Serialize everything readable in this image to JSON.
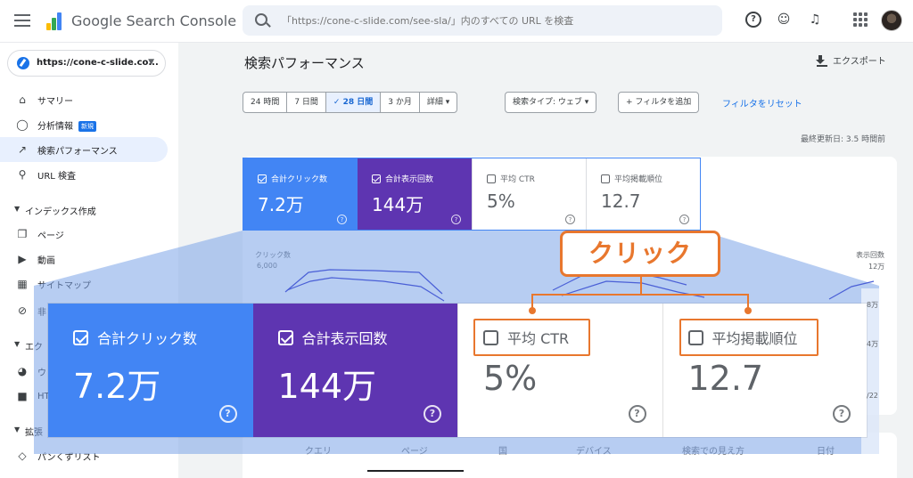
{
  "app": {
    "title": "Google Search Console"
  },
  "search": {
    "placeholder": "「https://cone-c-slide.com/see-sla/」内のすべての URL を検査"
  },
  "property": {
    "label": "https://cone-c-slide.co..."
  },
  "sidebar": {
    "items": [
      {
        "label": "サマリー",
        "icon": "home-icon"
      },
      {
        "label": "分析情報",
        "icon": "lightbulb-icon",
        "badge": "新規"
      },
      {
        "label": "検索パフォーマンス",
        "icon": "trending-up-icon",
        "active": true
      },
      {
        "label": "URL 検査",
        "icon": "search-icon"
      }
    ],
    "section_index": "インデックス作成",
    "index_items": [
      {
        "label": "ページ",
        "icon": "pages-icon"
      },
      {
        "label": "動画",
        "icon": "video-icon"
      },
      {
        "label": "サイトマップ",
        "icon": "sitemap-icon"
      },
      {
        "label": "非",
        "icon": "hidden-icon"
      }
    ],
    "section_experience": "エク",
    "experience_items": [
      {
        "label": "ウ",
        "icon": "gauge-icon"
      },
      {
        "label": "HT",
        "icon": "lock-icon"
      }
    ],
    "section_extensions": "拡張",
    "extension_items": [
      {
        "label": "パンくずリスト",
        "icon": "layers-icon"
      }
    ]
  },
  "main": {
    "title": "検索パフォーマンス",
    "export_label": "エクスポート",
    "date_ranges": [
      "24 時間",
      "7 日間",
      "28 日間",
      "3 か月",
      "詳細"
    ],
    "selected_range": "28 日間",
    "search_type": "検索タイプ: ウェブ",
    "add_filter": "フィルタを追加",
    "reset_filters": "フィルタをリセット",
    "last_updated": "最終更新日: 3.5 時間前"
  },
  "metrics": [
    {
      "label": "合計クリック数",
      "value": "7.2万",
      "checked": true,
      "color": "#4285f4"
    },
    {
      "label": "合計表示回数",
      "value": "144万",
      "checked": true,
      "color": "#5e35b1"
    },
    {
      "label": "平均 CTR",
      "value": "5%",
      "checked": false
    },
    {
      "label": "平均掲載順位",
      "value": "12.7",
      "checked": false
    }
  ],
  "chart_axis": {
    "left_label": "クリック数",
    "left_max": "6,000",
    "right_label": "表示回数",
    "right_max": "12万",
    "right_ticks": [
      "8万",
      "4万"
    ],
    "x_end": "/22"
  },
  "callout": {
    "text": "クリック",
    "color": "#e8772e"
  },
  "tabs": [
    "クエリ",
    "ページ",
    "国",
    "デバイス",
    "検索での見え方",
    "日付"
  ],
  "selected_tab": "ページ"
}
